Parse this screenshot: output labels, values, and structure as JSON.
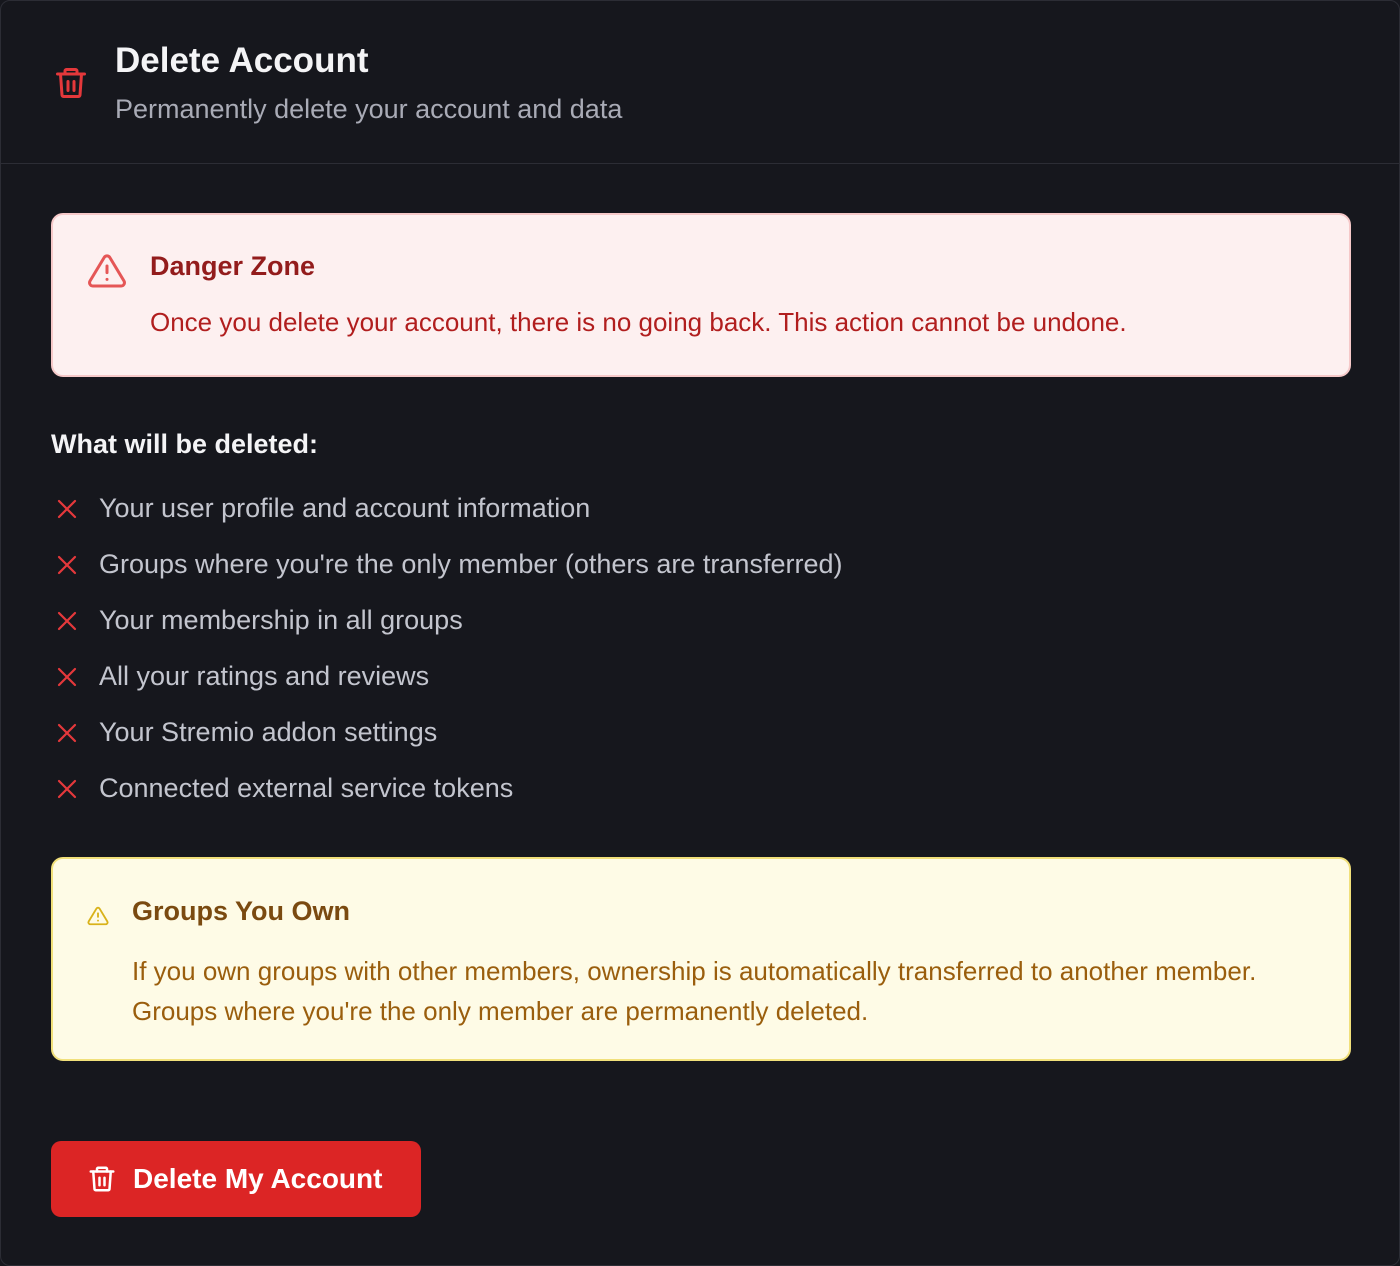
{
  "header": {
    "title": "Delete Account",
    "subtitle": "Permanently delete your account and data",
    "icon": "trash-icon"
  },
  "danger_zone": {
    "title": "Danger Zone",
    "message": "Once you delete your account, there is no going back. This action cannot be undone.",
    "icon": "warning-triangle-icon"
  },
  "deletion_list": {
    "title": "What will be deleted:",
    "items": [
      "Your user profile and account information",
      "Groups where you're the only member (others are transferred)",
      "Your membership in all groups",
      "All your ratings and reviews",
      "Your Stremio addon settings",
      "Connected external service tokens"
    ]
  },
  "groups_notice": {
    "title": "Groups You Own",
    "message": "If you own groups with other members, ownership is automatically transferred to another member. Groups where you're the only member are permanently deleted.",
    "icon": "warning-triangle-icon"
  },
  "actions": {
    "delete_label": "Delete My Account"
  },
  "colors": {
    "background": "#16171d",
    "danger": "#dc2525",
    "danger_text": "#b11e1e",
    "danger_box_bg": "#fdf0f0",
    "warning_box_bg": "#fefbe6",
    "warning_text": "#9a5e0d"
  }
}
